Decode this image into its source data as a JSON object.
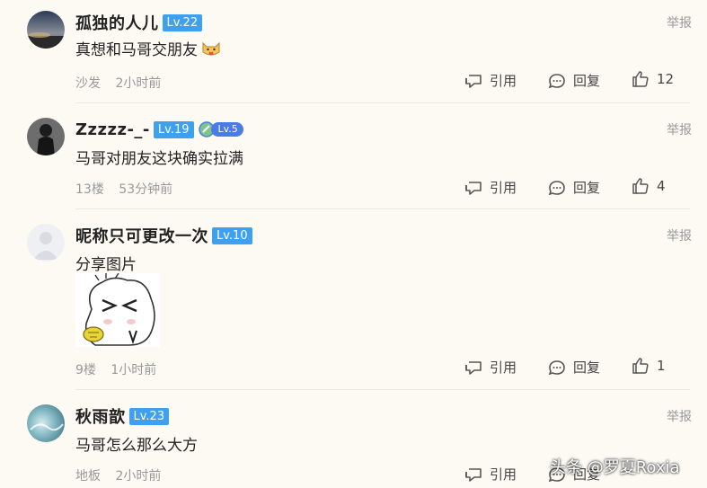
{
  "comments": [
    {
      "username": "孤独的人儿",
      "level": "Lv.22",
      "text": "真想和马哥交朋友",
      "floor": "沙发",
      "time": "2小时前",
      "quote_label": "引用",
      "reply_label": "回复",
      "likes": "12",
      "report_label": "举报"
    },
    {
      "username": "Zzzzz-_-",
      "level": "Lv.19",
      "medal_level": "Lv.5",
      "text": "马哥对朋友这块确实拉满",
      "floor": "13楼",
      "time": "53分钟前",
      "quote_label": "引用",
      "reply_label": "回复",
      "likes": "4",
      "report_label": "举报"
    },
    {
      "username": "昵称只可更改一次",
      "level": "Lv.10",
      "text": "分享图片",
      "floor": "9楼",
      "time": "1小时前",
      "quote_label": "引用",
      "reply_label": "回复",
      "likes": "1",
      "report_label": "举报"
    },
    {
      "username": "秋雨歆",
      "level": "Lv.23",
      "text": "马哥怎么那么大方",
      "floor": "地板",
      "time": "2小时前",
      "quote_label": "引用",
      "reply_label": "回复",
      "report_label": "举报"
    }
  ],
  "watermark": "头条 @罗夏Roxia",
  "colors": {
    "level_badge": "#3fa0f0",
    "medal_badge": "#4a7be8",
    "background": "#fcfaf3",
    "muted_text": "#999999"
  },
  "icons": {
    "quote": "quote-icon",
    "reply": "reply-bubble-icon",
    "like": "thumbs-up-icon",
    "emoji": "cat-face-emoji"
  }
}
